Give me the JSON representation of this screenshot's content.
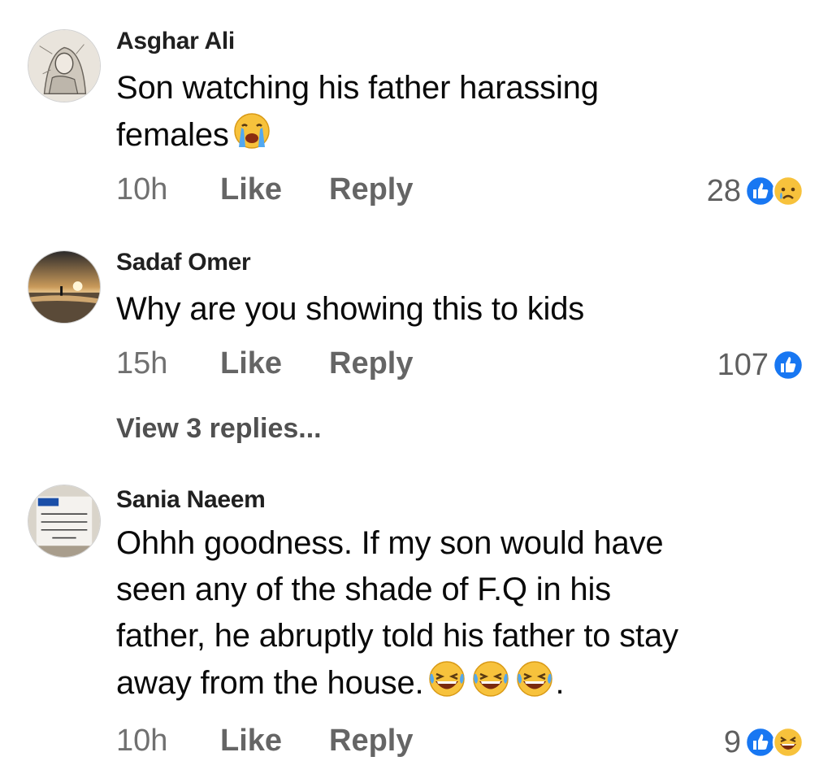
{
  "comments": [
    {
      "author": "Asghar Ali",
      "lines": [
        "Son watching his father harassing",
        "females"
      ],
      "emoji": [
        "crying-face"
      ],
      "time": "10h",
      "like": "Like",
      "reply": "Reply",
      "reaction_count": "28",
      "reactions": [
        "like",
        "sad"
      ]
    },
    {
      "author": "Sadaf Omer",
      "lines": [
        "Why are you showing this to kids"
      ],
      "time": "15h",
      "like": "Like",
      "reply": "Reply",
      "reaction_count": "107",
      "reactions": [
        "like"
      ],
      "view_replies": "View 3 replies..."
    },
    {
      "author": "Sania Naeem",
      "lines": [
        "Ohhh goodness. If my son would have",
        "seen any of the shade of F.Q in his",
        "father, he abruptly told his father to stay",
        "away from the house."
      ],
      "trailing": ".",
      "emoji": [
        "laughing-face",
        "laughing-face",
        "laughing-face"
      ],
      "time": "10h",
      "like": "Like",
      "reply": "Reply",
      "reaction_count": "9",
      "reactions": [
        "like",
        "haha"
      ]
    }
  ],
  "colors": {
    "like_blue": "#1877f2",
    "emoji_yellow": "#f7c23c"
  }
}
